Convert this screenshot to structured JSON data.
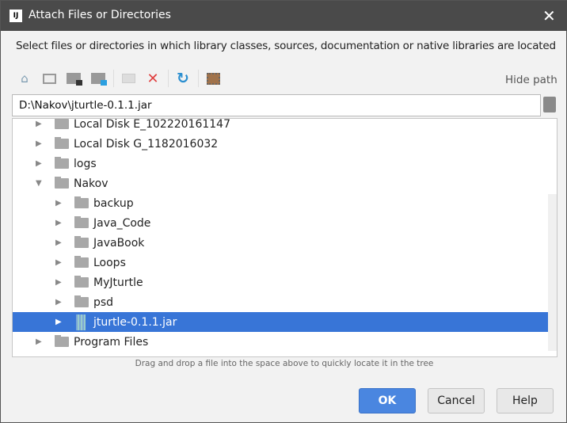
{
  "window": {
    "title": "Attach Files or Directories",
    "app_icon": "IJ",
    "close": "✕"
  },
  "description": "Select files or directories in which library classes, sources, documentation or native libraries are located",
  "toolbar": {
    "icons": [
      "home-icon",
      "desktop-icon",
      "project-icon",
      "module-icon",
      "new-folder-icon",
      "delete-icon",
      "refresh-icon",
      "show-hidden-icon"
    ],
    "hide_path": "Hide path"
  },
  "path": {
    "value": "D:\\Nakov\\jturtle-0.1.1.jar"
  },
  "tree": {
    "items": [
      {
        "label": "Local Disk E_102220161147",
        "type": "folder",
        "level": 0,
        "expanded": false
      },
      {
        "label": "Local Disk G_1182016032",
        "type": "folder",
        "level": 0,
        "expanded": false
      },
      {
        "label": "logs",
        "type": "folder",
        "level": 0,
        "expanded": false
      },
      {
        "label": "Nakov",
        "type": "folder",
        "level": 0,
        "expanded": true
      },
      {
        "label": "backup",
        "type": "folder",
        "level": 1,
        "expanded": false
      },
      {
        "label": "Java_Code",
        "type": "folder",
        "level": 1,
        "expanded": false
      },
      {
        "label": "JavaBook",
        "type": "folder",
        "level": 1,
        "expanded": false
      },
      {
        "label": "Loops",
        "type": "folder",
        "level": 1,
        "expanded": false
      },
      {
        "label": "MyJturtle",
        "type": "folder",
        "level": 1,
        "expanded": false
      },
      {
        "label": "psd",
        "type": "folder",
        "level": 1,
        "expanded": false
      },
      {
        "label": "jturtle-0.1.1.jar",
        "type": "jar",
        "level": 1,
        "expanded": false,
        "selected": true
      },
      {
        "label": "Program Files",
        "type": "folder",
        "level": 0,
        "expanded": false
      }
    ]
  },
  "hint": "Drag and drop a file into the space above to quickly locate it in the tree",
  "buttons": {
    "ok": "OK",
    "cancel": "Cancel",
    "help": "Help"
  },
  "colors": {
    "selection": "#3875d7",
    "ok": "#4a86e0",
    "titlebar": "#4a4a4a"
  }
}
